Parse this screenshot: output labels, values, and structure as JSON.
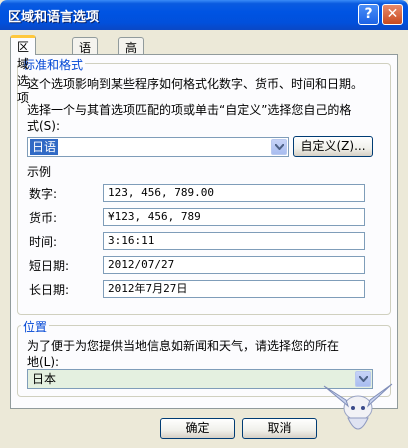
{
  "window": {
    "title": "区域和语言选项"
  },
  "titlebar_buttons": {
    "help": "?",
    "close": "✕"
  },
  "tabs": [
    {
      "label": "区域选项",
      "active": true
    },
    {
      "label": "语言",
      "active": false
    },
    {
      "label": "高级",
      "active": false
    }
  ],
  "standards": {
    "group_label": "标准和格式",
    "desc": "这个选项影响到某些程序如何格式化数字、货币、时间和日期。",
    "instruction_line1": "选择一个与其首选项匹配的项或单击“自定义”选择您自己的格",
    "instruction_line2": "式(S):",
    "selected_format": "日语",
    "customize_button": "自定义(Z)..."
  },
  "examples": {
    "label": "示例",
    "rows": [
      {
        "label": "数字:",
        "value": "123, 456, 789.00"
      },
      {
        "label": "货币:",
        "value": "¥123, 456, 789"
      },
      {
        "label": "时间:",
        "value": "3:16:11"
      },
      {
        "label": "短日期:",
        "value": "2012/07/27"
      },
      {
        "label": "长日期:",
        "value": "2012年7月27日"
      }
    ]
  },
  "location": {
    "group_label": "位置",
    "desc_line1": "为了便于为您提供当地信息如新闻和天气，请选择您的所在",
    "desc_line2": "地(L):",
    "selected": "日本"
  },
  "footer": {
    "ok": "确定",
    "cancel": "取消"
  },
  "colors": {
    "titlebar": "#0054e3",
    "group_label": "#0046d5",
    "selection": "#316ac5",
    "dialog_bg": "#ece9d8"
  }
}
